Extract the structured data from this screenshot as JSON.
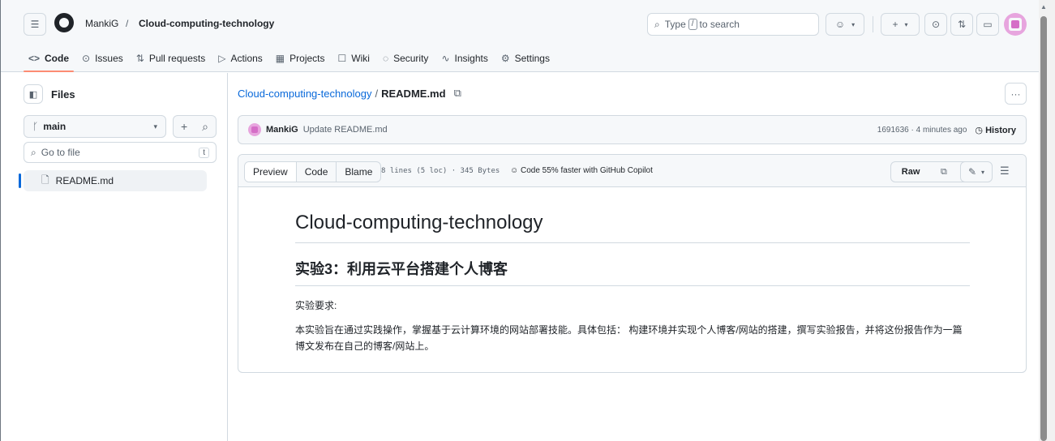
{
  "header": {
    "owner": "MankiG",
    "separator": "/",
    "repo": "Cloud-computing-technology",
    "search_prefix": "Type",
    "search_key": "/",
    "search_suffix": "to search"
  },
  "tabs": [
    {
      "label": "Code",
      "icon": "<>",
      "active": true
    },
    {
      "label": "Issues",
      "icon": "⊙"
    },
    {
      "label": "Pull requests",
      "icon": "⇅"
    },
    {
      "label": "Actions",
      "icon": "▷"
    },
    {
      "label": "Projects",
      "icon": "▦"
    },
    {
      "label": "Wiki",
      "icon": "☐"
    },
    {
      "label": "Security",
      "icon": "◌"
    },
    {
      "label": "Insights",
      "icon": "∿"
    },
    {
      "label": "Settings",
      "icon": "⚙"
    }
  ],
  "sidebar": {
    "title": "Files",
    "branch": "main",
    "goto_placeholder": "Go to file",
    "goto_key": "t",
    "files": [
      {
        "name": "README.md"
      }
    ]
  },
  "main": {
    "path_repo": "Cloud-computing-technology",
    "path_sep": "/",
    "path_file": "README.md",
    "commit": {
      "author": "MankiG",
      "message": "Update README.md",
      "meta": "1691636 · 4 minutes ago",
      "history": "History"
    },
    "viewer": {
      "tab_preview": "Preview",
      "tab_code": "Code",
      "tab_blame": "Blame",
      "info": "8 lines (5 loc) · 345 Bytes",
      "copilot": "Code 55% faster with GitHub Copilot",
      "raw": "Raw"
    },
    "readme": {
      "h1": "Cloud-computing-technology",
      "h2": "实验3：利用云平台搭建个人博客",
      "p1": "实验要求:",
      "p2": "本实验旨在通过实践操作，掌握基于云计算环境的网站部署技能。具体包括： 构建环境并实现个人博客/网站的搭建，撰写实验报告，并将这份报告作为一篇博文发布在自己的博客/网站上。"
    }
  },
  "colors": {
    "accent": "#0969da",
    "tab_underline": "#fd8c73",
    "avatar": "#e7a5de"
  }
}
